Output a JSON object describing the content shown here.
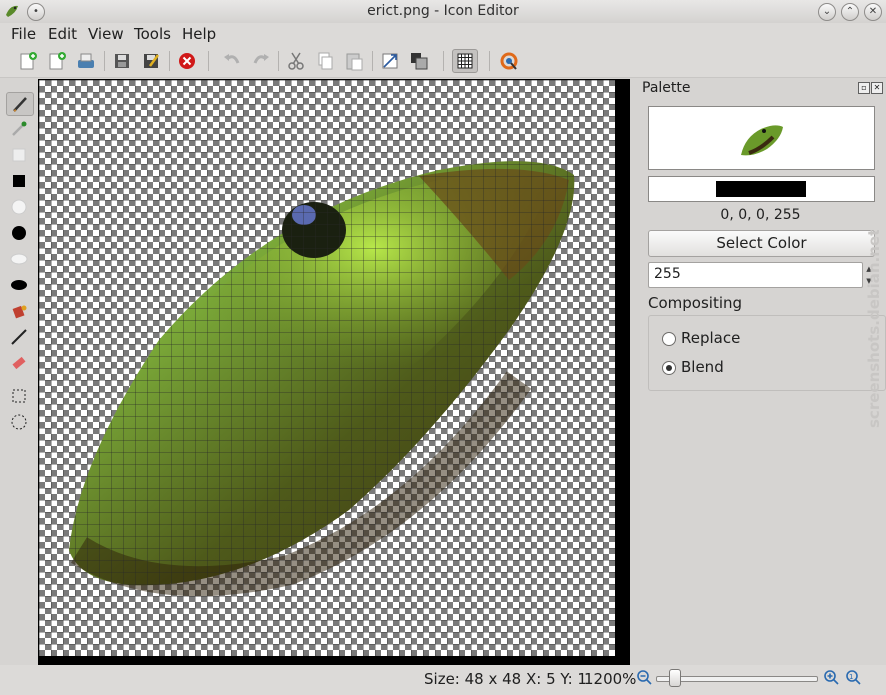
{
  "window": {
    "title": "erict.png - Icon Editor"
  },
  "menu": [
    "File",
    "Edit",
    "View",
    "Tools",
    "Help"
  ],
  "toolbar": {
    "icons": [
      "new-icon",
      "new-from-icon",
      "open-icon",
      "save-icon",
      "save-as-icon",
      "close-icon",
      "undo-icon",
      "redo-icon",
      "cut-icon",
      "copy-icon",
      "paste-icon",
      "resize-icon",
      "grayscale-icon",
      "grid-icon",
      "about-icon"
    ]
  },
  "tools": [
    "freehand",
    "color-picker",
    "rectangle",
    "filled-rectangle",
    "circle",
    "filled-circle",
    "ellipse",
    "filled-ellipse",
    "fill",
    "line",
    "eraser",
    "rectangle-select",
    "circle-select"
  ],
  "palette": {
    "title": "Palette",
    "rgba_text": "0, 0, 0, 255",
    "select_color_label": "Select Color",
    "alpha_value": "255",
    "compositing_label": "Compositing",
    "replace_label": "Replace",
    "blend_label": "Blend",
    "selected_mode": "Blend",
    "current_color": "#000000"
  },
  "watermark": {
    "text": "screenshots.debian.net"
  },
  "status": {
    "size_text": "Size: 48 x 48",
    "pos_text": "X: 5 Y: 1",
    "zoom_text": "1200%",
    "zoom_level": 0.12
  }
}
